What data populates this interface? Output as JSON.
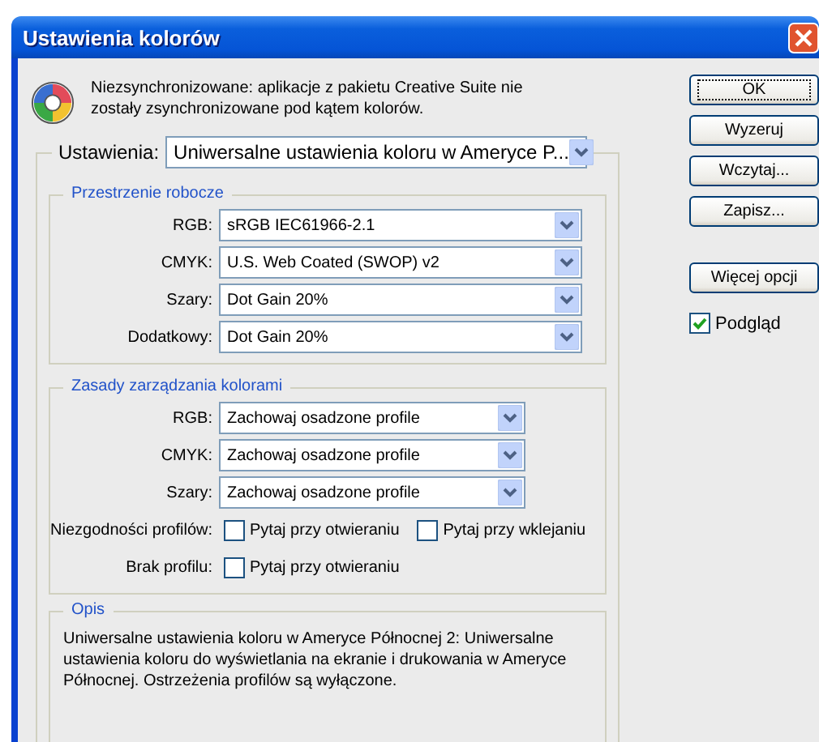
{
  "window": {
    "title": "Ustawienia kolorów"
  },
  "notice": "Niezsynchronizowane: aplikacje z pakietu Creative Suite nie zostały zsynchronizowane pod kątem kolorów.",
  "settings": {
    "label": "Ustawienia:",
    "value": "Uniwersalne ustawienia koloru w Ameryce P..."
  },
  "working_spaces": {
    "title": "Przestrzenie robocze",
    "fields": [
      {
        "label": "RGB:",
        "value": "sRGB IEC61966-2.1"
      },
      {
        "label": "CMYK:",
        "value": "U.S. Web Coated (SWOP) v2"
      },
      {
        "label": "Szary:",
        "value": "Dot Gain 20%"
      },
      {
        "label": "Dodatkowy:",
        "value": "Dot Gain 20%"
      }
    ]
  },
  "policies": {
    "title": "Zasady zarządzania kolorami",
    "fields": [
      {
        "label": "RGB:",
        "value": "Zachowaj osadzone profile"
      },
      {
        "label": "CMYK:",
        "value": "Zachowaj osadzone profile"
      },
      {
        "label": "Szary:",
        "value": "Zachowaj osadzone profile"
      }
    ],
    "options": [
      {
        "label": "Niezgodności profilów:",
        "checkboxes": [
          {
            "label": "Pytaj przy otwieraniu",
            "checked": false
          },
          {
            "label": "Pytaj przy wklejaniu",
            "checked": false
          }
        ]
      },
      {
        "label": "Brak profilu:",
        "checkboxes": [
          {
            "label": "Pytaj przy otwieraniu",
            "checked": false
          }
        ]
      }
    ]
  },
  "description": {
    "title": "Opis",
    "text": "Uniwersalne ustawienia koloru w Ameryce Północnej 2:  Uniwersalne ustawienia koloru do wyświetlania na ekranie i drukowania w Ameryce Północnej. Ostrzeżenia profilów są wyłączone."
  },
  "buttons": [
    {
      "label": "OK",
      "default": true
    },
    {
      "label": "Wyzeruj",
      "default": false
    },
    {
      "label": "Wczytaj...",
      "default": false
    },
    {
      "label": "Zapisz...",
      "default": false
    },
    {
      "label": "Więcej opcji",
      "default": false
    }
  ],
  "preview": {
    "label": "Podgląd",
    "checked": true
  }
}
